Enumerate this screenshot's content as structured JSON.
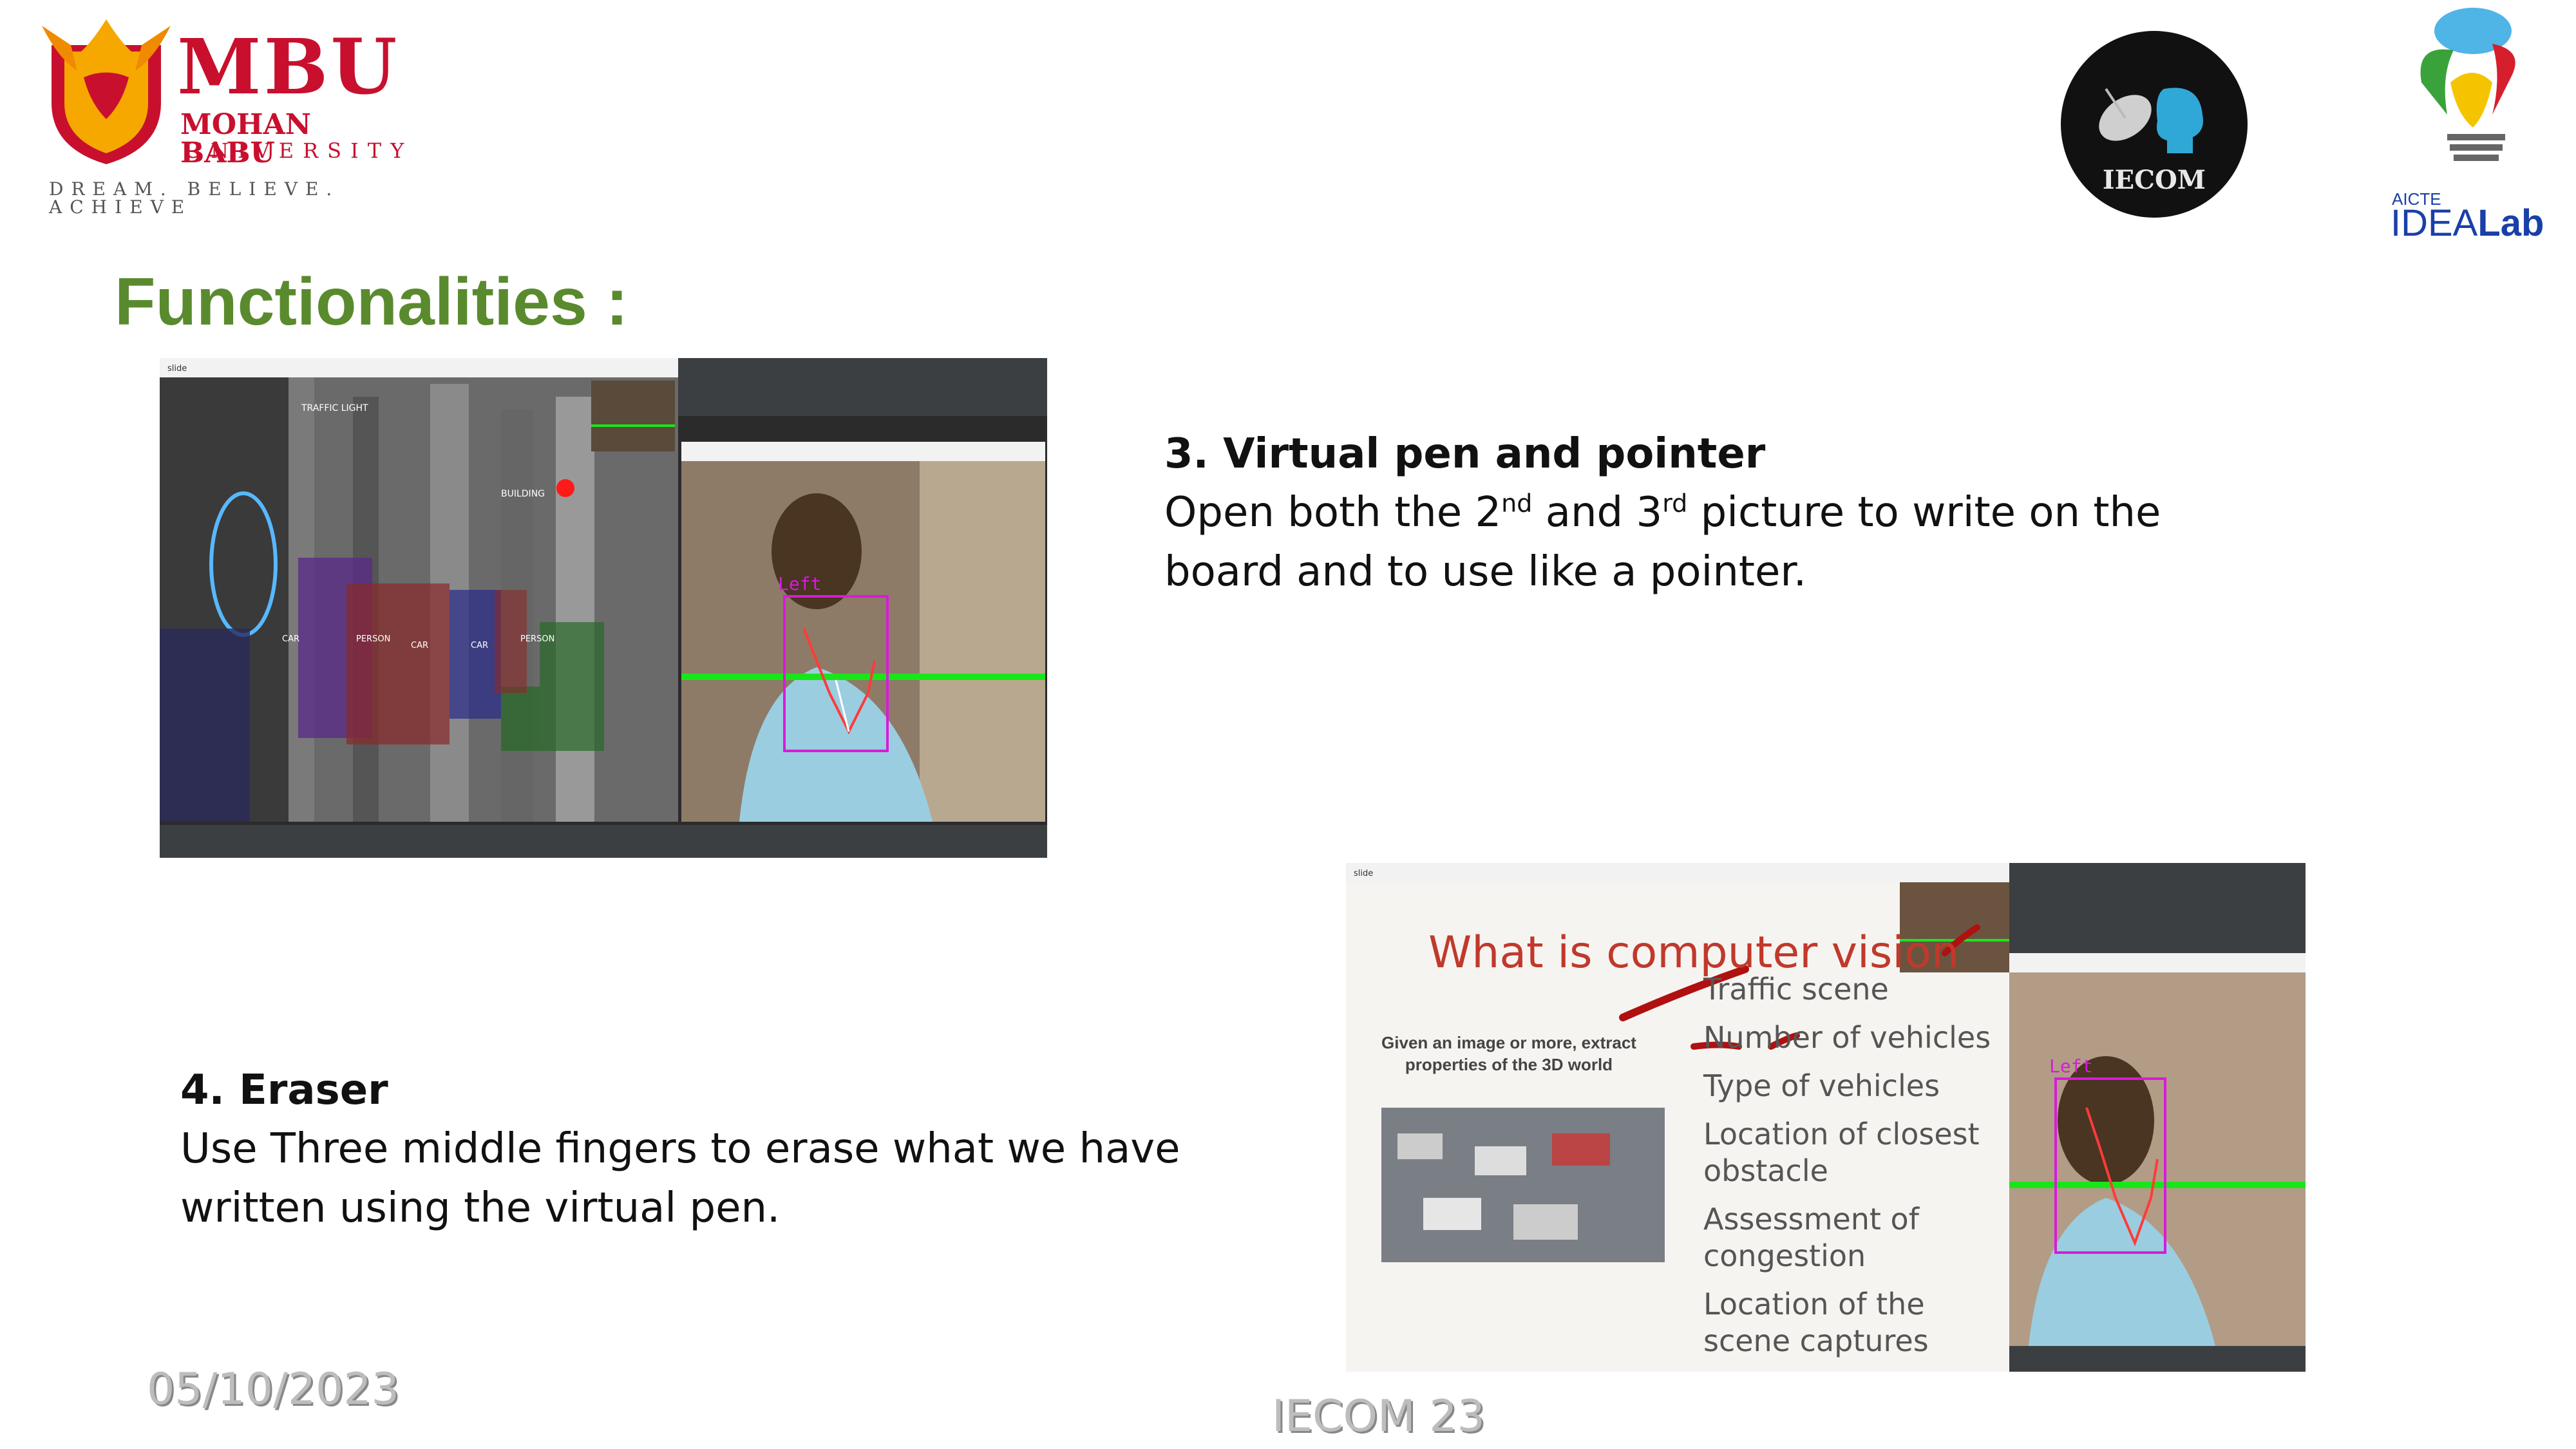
{
  "logo_mbu": {
    "short": "MBU",
    "line1": "MOHAN BABU",
    "line2": "UNIVERSITY",
    "tagline": "DREAM. BELIEVE. ACHIEVE"
  },
  "logo_iecom": {
    "label": "IECOM"
  },
  "logo_idea": {
    "aicte": "AICTE",
    "idea": "IDEA",
    "lab": "Lab"
  },
  "heading": "Functionalities :",
  "section3": {
    "title": "3. Virtual pen and pointer",
    "body_a": "Open both the 2",
    "sup_a": "nd",
    "body_b": " and 3",
    "sup_b": "rd",
    "body_c": " picture to write on the",
    "body_d": "board and to use like a pointer."
  },
  "section4": {
    "title": "4. Eraser",
    "line1": "Use Three middle fingers to erase what we have",
    "line2": "written using the virtual pen."
  },
  "screenshot1": {
    "window_title": "slide",
    "cam_label": "Left",
    "labels": [
      "TRAFFIC LIGHT",
      "BUILDING",
      "CAR",
      "PERSON",
      "CAR",
      "CAR",
      "PERSON"
    ]
  },
  "screenshot2": {
    "window_title": "slide",
    "slide_title": "What is computer vision",
    "left_caption_1": "Given an image or more, extract",
    "left_caption_2": "properties of the 3D world",
    "bullets": [
      "Traffic scene",
      "Number of vehicles",
      "Type of vehicles",
      "Location of closest",
      "obstacle",
      "Assessment of",
      "congestion",
      "Location of the",
      "scene captures"
    ],
    "cam_label": "Left"
  },
  "footer": {
    "date": "05/10/2023",
    "conf": "IECOM 23"
  },
  "colors": {
    "heading": "#5a8a2e",
    "brand_red": "#c8102e",
    "idea_blue": "#1a3fa8"
  }
}
